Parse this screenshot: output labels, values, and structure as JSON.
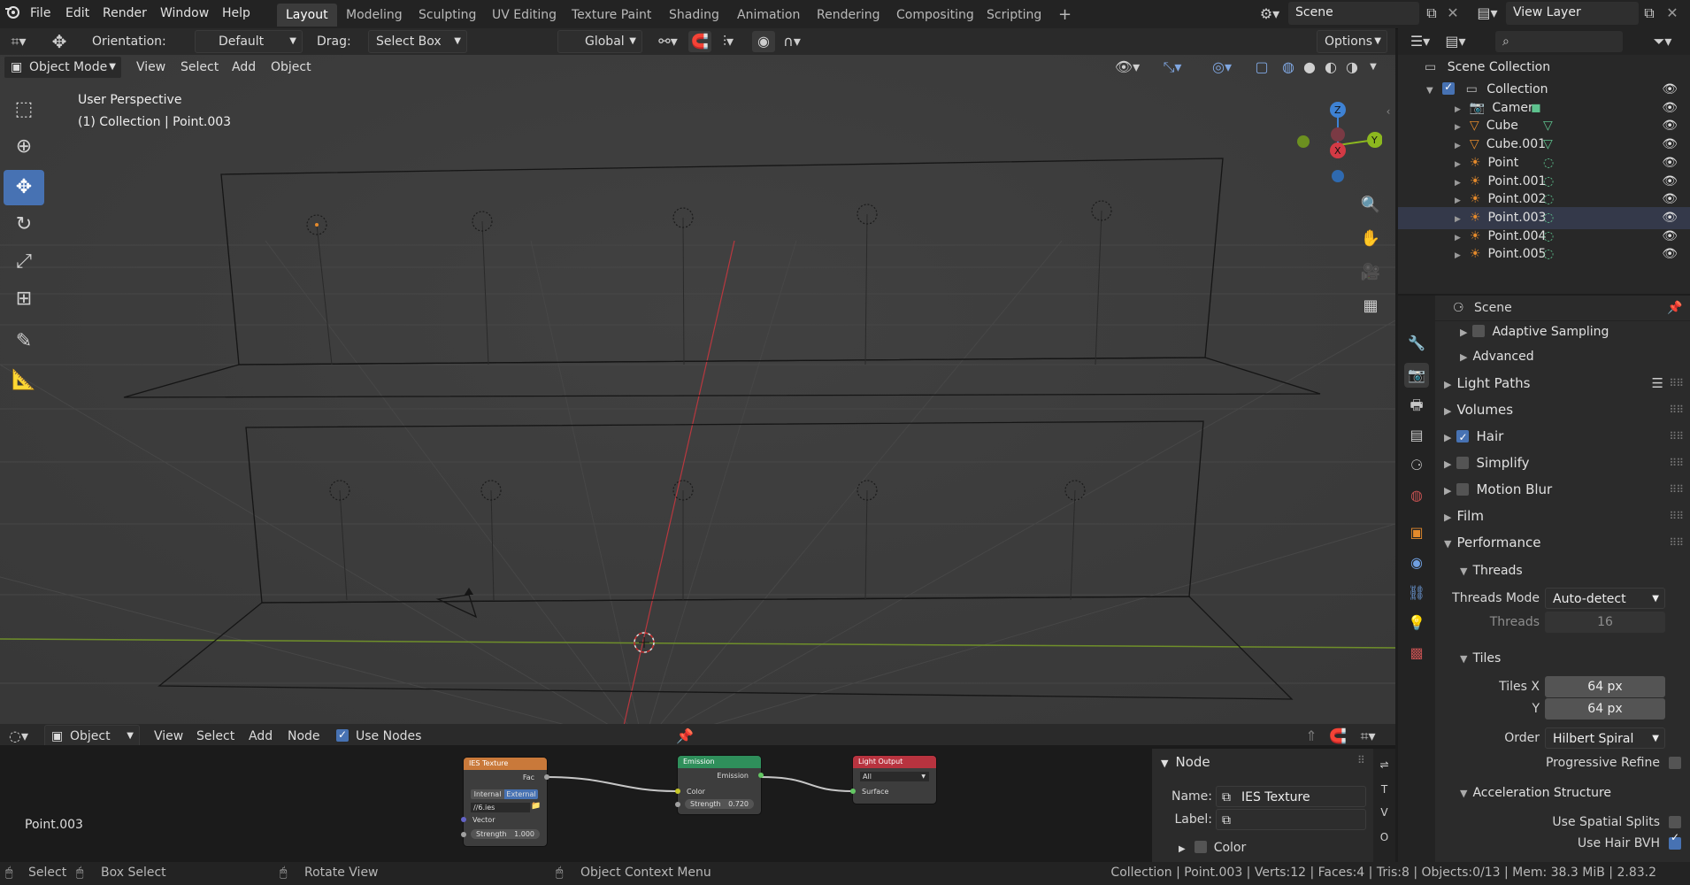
{
  "topbar": {
    "menus": [
      "File",
      "Edit",
      "Render",
      "Window",
      "Help"
    ],
    "workspaces": [
      "Layout",
      "Modeling",
      "Sculpting",
      "UV Editing",
      "Texture Paint",
      "Shading",
      "Animation",
      "Rendering",
      "Compositing",
      "Scripting"
    ],
    "active_workspace": "Layout",
    "add_tab": "+",
    "scene_name": "Scene",
    "view_layer": "View Layer"
  },
  "viewport": {
    "orientation_label": "Orientation:",
    "orientation_value": "Default",
    "drag_label": "Drag:",
    "drag_value": "Select Box",
    "transform_space": "Global",
    "options_label": "Options",
    "mode": "Object Mode",
    "header_menus": [
      "View",
      "Select",
      "Add",
      "Object"
    ],
    "overlay_title": "User Perspective",
    "overlay_subtitle": "(1) Collection | Point.003",
    "gizmo_axes": {
      "x": "X",
      "y": "Y",
      "z": "Z"
    }
  },
  "outliner": {
    "root": "Scene Collection",
    "items": [
      {
        "name": "Collection",
        "icon": "collection-icon",
        "indent": 0
      },
      {
        "name": "Camera",
        "icon": "camera-icon",
        "indent": 1
      },
      {
        "name": "Cube",
        "icon": "mesh-icon",
        "indent": 1
      },
      {
        "name": "Cube.001",
        "icon": "mesh-icon",
        "indent": 1
      },
      {
        "name": "Point",
        "icon": "light-icon",
        "indent": 1
      },
      {
        "name": "Point.001",
        "icon": "light-icon",
        "indent": 1
      },
      {
        "name": "Point.002",
        "icon": "light-icon",
        "indent": 1
      },
      {
        "name": "Point.003",
        "icon": "light-icon",
        "indent": 1,
        "selected": true
      },
      {
        "name": "Point.004",
        "icon": "light-icon",
        "indent": 1
      },
      {
        "name": "Point.005",
        "icon": "light-icon",
        "indent": 1
      }
    ]
  },
  "properties": {
    "context": "Scene",
    "panels": [
      {
        "label": "Adaptive Sampling",
        "sub": true,
        "checkbox": false
      },
      {
        "label": "Advanced",
        "sub": true
      },
      {
        "label": "Light Paths"
      },
      {
        "label": "Volumes"
      },
      {
        "label": "Hair",
        "checkbox": true
      },
      {
        "label": "Simplify",
        "checkbox": false
      },
      {
        "label": "Motion Blur",
        "checkbox": false
      },
      {
        "label": "Film"
      },
      {
        "label": "Performance",
        "open": true
      }
    ],
    "threads": {
      "header": "Threads",
      "mode_label": "Threads Mode",
      "mode_value": "Auto-detect",
      "count_label": "Threads",
      "count_value": "16"
    },
    "tiles": {
      "header": "Tiles",
      "x_label": "Tiles X",
      "x_value": "64 px",
      "y_label": "Y",
      "y_value": "64 px",
      "order_label": "Order",
      "order_value": "Hilbert Spiral",
      "progressive_label": "Progressive Refine"
    },
    "accel": {
      "header": "Acceleration Structure",
      "spatial_label": "Use Spatial Splits",
      "hair_bvh_label": "Use Hair BVH"
    }
  },
  "node_editor": {
    "type": "Object",
    "menus": [
      "View",
      "Select",
      "Add",
      "Node"
    ],
    "use_nodes_label": "Use Nodes",
    "object_name": "Point.003",
    "nodes": {
      "ies": {
        "title": "IES Texture",
        "out": "Fac",
        "btn_internal": "Internal",
        "btn_external": "External",
        "file": "//6.ies",
        "in_vector": "Vector",
        "strength_label": "Strength",
        "strength_value": "1.000"
      },
      "emission": {
        "title": "Emission",
        "out": "Emission",
        "in_color": "Color",
        "strength_label": "Strength",
        "strength_value": "0.720"
      },
      "output": {
        "title": "Light Output",
        "target": "All",
        "in_surface": "Surface"
      }
    },
    "side_panel": {
      "header": "Node",
      "name_label": "Name:",
      "name_value": "IES Texture",
      "label_label": "Label:",
      "label_value": "",
      "color_label": "Color"
    }
  },
  "statusbar": {
    "select": "Select",
    "box_select": "Box Select",
    "rotate_view": "Rotate View",
    "context_menu": "Object Context Menu",
    "stats": "Collection | Point.003 | Verts:12 | Faces:4 | Tris:8 | Objects:0/13 | Mem: 38.3 MiB | 2.83.2"
  }
}
